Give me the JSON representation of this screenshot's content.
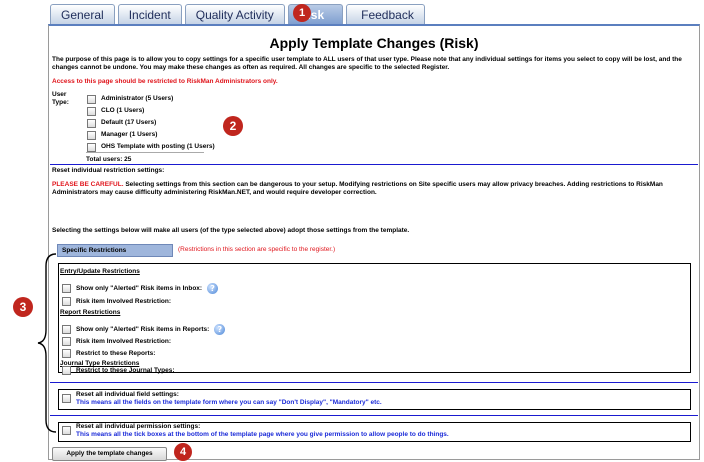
{
  "tabs": [
    "General",
    "Incident",
    "Quality Activity",
    "Risk",
    "Feedback"
  ],
  "active_tab": "Risk",
  "page_title": "Apply Template Changes (Risk)",
  "intro_text": "The purpose of this page is to allow you to copy settings for a specific user template to ALL users of that user type. Please note that any individual settings for items you select to copy will be lost, and the changes cannot be undone. You may make these changes as often as required. All changes are specific to the selected Register.",
  "access_note": "Access to this page should be restricted to RiskMan Administrators only.",
  "user_type_label": "User Type:",
  "user_types": [
    "Administrator (5 Users)",
    "CLO (1 Users)",
    "Default (17 Users)",
    "Manager (1 Users)",
    "OHS Template with posting (1 Users)"
  ],
  "total_users": "Total users: 25",
  "reset_restriction_heading": "Reset individual restriction settings:",
  "careful_prefix": "PLEASE BE CAREFUL.",
  "careful_text": " Selecting settings from this section can be dangerous to your setup. Modifying restrictions on Site specific users may allow privacy breaches. Adding restrictions to RiskMan Administrators may cause difficulty administering RiskMan.NET, and would require developer correction.",
  "selecting_text": "Selecting the settings below will make all users (of the type selected above) adopt those settings from the template.",
  "specific_restrictions_btn": "Specific Restrictions",
  "specific_note": "(Restrictions in this section are specific to the register.)",
  "entry_heading": "Entry/Update Restrictions",
  "entry_items": [
    "Show only \"Alerted\" Risk items in Inbox:",
    "Risk item Involved Restriction:"
  ],
  "report_heading": "Report Restrictions",
  "report_items": [
    "Show only \"Alerted\" Risk items in Reports:",
    "Risk item Involved Restriction:",
    "Restrict to these Reports:"
  ],
  "journal_heading": "Journal Type Restrictions",
  "journal_items": [
    "Restrict to these Journal Types:"
  ],
  "reset_field_title": "Reset all individual field settings:",
  "reset_field_desc": "This means all the fields on the template form where you can say \"Don't Display\", \"Mandatory\" etc.",
  "reset_perm_title": "Reset all individual permission settings:",
  "reset_perm_desc": "This means all the tick boxes at the bottom of the template page where you give permission to allow people to do things.",
  "apply_button": "Apply the template changes",
  "callouts": [
    "1",
    "2",
    "3",
    "4"
  ],
  "colors": {
    "callout": "#c0261e",
    "warning": "#e0141b",
    "link_blue": "#1a2ad8",
    "tab_active": "#7f9fd0"
  }
}
